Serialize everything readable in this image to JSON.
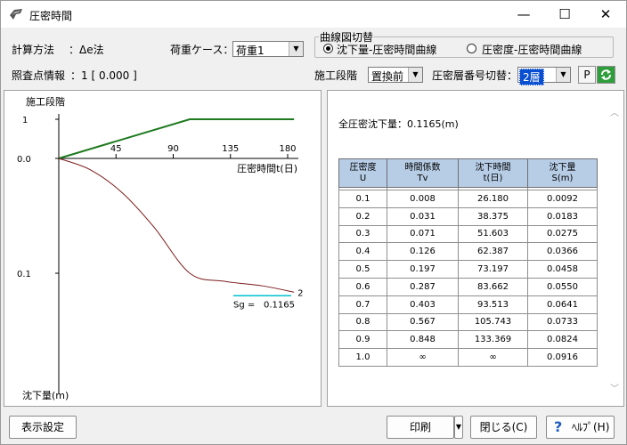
{
  "window": {
    "title": "圧密時間"
  },
  "top": {
    "calc_method_label": "計算方法",
    "calc_method_value": "：Δe法",
    "load_case_label": "荷重ケース：",
    "load_case_value": "荷重1",
    "check_point_label": "照査点情報",
    "check_point_value": "：1 [ 0.000 ]",
    "curve_group_label": "曲線図切替",
    "radio1_label": "沈下量-圧密時間曲線",
    "radio2_label": "圧密度-圧密時間曲線",
    "radio_selected": 1,
    "stage_label": "施工段階",
    "stage_value": "置換前",
    "layer_label": "圧密層番号切替：",
    "layer_value": "2層",
    "p_button": "P"
  },
  "chart_data": {
    "type": "line",
    "stage_title": "施工段階",
    "stage_ticks": [
      "1",
      "0.0"
    ],
    "x_ticks": [
      "45",
      "90",
      "135",
      "180"
    ],
    "x_label": "圧密時間t(日)",
    "y_ticks": [
      "0.0",
      "0.1"
    ],
    "y_label": "沈下量(m)",
    "stage_curve": {
      "points": [
        [
          0,
          0
        ],
        [
          103,
          1
        ],
        [
          185,
          1
        ]
      ],
      "color": "#1e7a1e"
    },
    "settlement_curve": {
      "points": [
        [
          0,
          0
        ],
        [
          25,
          0.01
        ],
        [
          50,
          0.03
        ],
        [
          75,
          0.06
        ],
        [
          103,
          0.1
        ],
        [
          130,
          0.107
        ],
        [
          160,
          0.111
        ],
        [
          185,
          0.1165
        ]
      ],
      "color": "#7a1a1a",
      "end_label": "2"
    },
    "sg_label": "Sg =",
    "sg_value": "0.1165",
    "sg_line_color": "#00c0d0"
  },
  "results": {
    "total_label": "全圧密沈下量：0.1165(m)",
    "headers": [
      [
        "圧密度",
        "U"
      ],
      [
        "時間係数",
        "Tv"
      ],
      [
        "沈下時間",
        "t(日)"
      ],
      [
        "沈下量",
        "S(m)"
      ]
    ],
    "rows": [
      [
        "0.1",
        "0.008",
        "26.180",
        "0.0092"
      ],
      [
        "0.2",
        "0.031",
        "38.375",
        "0.0183"
      ],
      [
        "0.3",
        "0.071",
        "51.603",
        "0.0275"
      ],
      [
        "0.4",
        "0.126",
        "62.387",
        "0.0366"
      ],
      [
        "0.5",
        "0.197",
        "73.197",
        "0.0458"
      ],
      [
        "0.6",
        "0.287",
        "83.662",
        "0.0550"
      ],
      [
        "0.7",
        "0.403",
        "93.513",
        "0.0641"
      ],
      [
        "0.8",
        "0.567",
        "105.743",
        "0.0733"
      ],
      [
        "0.9",
        "0.848",
        "133.369",
        "0.0824"
      ],
      [
        "1.0",
        "∞",
        "∞",
        "0.0916"
      ]
    ]
  },
  "footer": {
    "display_settings": "表示設定",
    "print": "印刷",
    "close": "閉じる(C)",
    "help": "ﾍﾙﾌﾟ(H)"
  }
}
